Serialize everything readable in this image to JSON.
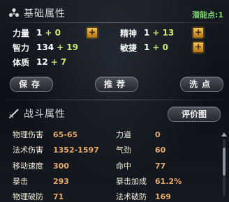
{
  "basic": {
    "title": "基础属性",
    "potential_label": "潜能点:",
    "potential_value": "1",
    "stats": [
      {
        "name": "力量",
        "base": "1",
        "bonus": "+ 0"
      },
      {
        "name": "精神",
        "base": "1",
        "bonus": "+ 13"
      },
      {
        "name": "智力",
        "base": "134",
        "bonus": "+ 19"
      },
      {
        "name": "敏捷",
        "base": "1",
        "bonus": "+ 0"
      },
      {
        "name": "体质",
        "base": "12",
        "bonus": "+ 7"
      }
    ],
    "plus_symbol": "+",
    "buttons": {
      "save": "保存",
      "recommend": "推荐",
      "reset": "洗点"
    }
  },
  "combat": {
    "title": "战斗属性",
    "rating_button": "评价图",
    "stats": [
      {
        "name": "物理伤害",
        "value": "65-65"
      },
      {
        "name": "力道",
        "value": "0"
      },
      {
        "name": "法术伤害",
        "value": "1352-1597"
      },
      {
        "name": "气劲",
        "value": "60"
      },
      {
        "name": "移动速度",
        "value": "300"
      },
      {
        "name": "命中",
        "value": "77"
      },
      {
        "name": "暴击",
        "value": "293"
      },
      {
        "name": "暴击加成",
        "value": "61.2%"
      },
      {
        "name": "物理破防",
        "value": "71"
      },
      {
        "name": "法术破防",
        "value": "169"
      }
    ]
  },
  "colors": {
    "bonus": "#c9e86a",
    "potential": "#7bd16c",
    "combat_value": "#e5a86a",
    "plus_button": "#e0a43a"
  },
  "icons": {
    "basic": "dice-icon",
    "combat": "sword-icon",
    "plus": "plus-icon",
    "scroll_up": "scroll-up-arrow-icon"
  }
}
